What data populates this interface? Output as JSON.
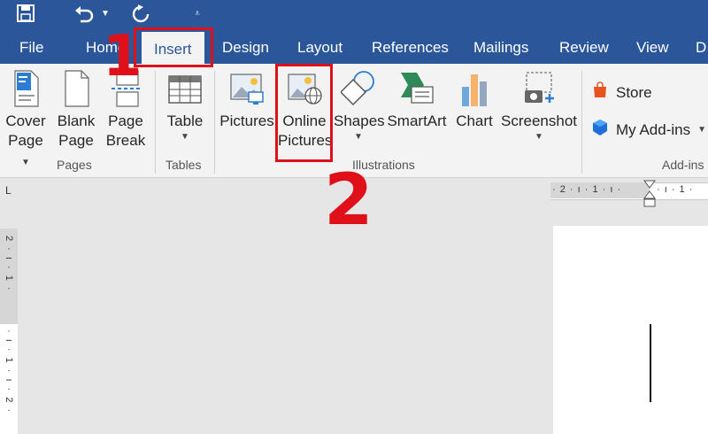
{
  "quick_access": {
    "icons": [
      "save-icon",
      "undo-icon",
      "redo-icon",
      "customize-qat-icon"
    ]
  },
  "tabs": [
    {
      "label": "File"
    },
    {
      "label": "Home"
    },
    {
      "label": "Insert",
      "active": true
    },
    {
      "label": "Design"
    },
    {
      "label": "Layout"
    },
    {
      "label": "References"
    },
    {
      "label": "Mailings"
    },
    {
      "label": "Review"
    },
    {
      "label": "View"
    },
    {
      "label": "D"
    }
  ],
  "ribbon": {
    "pages": {
      "group_label": "Pages",
      "cover_page": {
        "line1": "Cover",
        "line2": "Page"
      },
      "blank_page": {
        "line1": "Blank",
        "line2": "Page"
      },
      "page_break": {
        "line1": "Page",
        "line2": "Break"
      }
    },
    "tables": {
      "group_label": "Tables",
      "table": {
        "label": "Table"
      }
    },
    "illustrations": {
      "group_label": "Illustrations",
      "pictures": {
        "label": "Pictures"
      },
      "online_pictures": {
        "line1": "Online",
        "line2": "Pictures"
      },
      "shapes": {
        "label": "Shapes"
      },
      "smartart": {
        "label": "SmartArt"
      },
      "chart": {
        "label": "Chart"
      },
      "screenshot": {
        "label": "Screenshot"
      }
    },
    "addins": {
      "group_label": "Add-ins",
      "store": {
        "label": "Store"
      },
      "my_addins": {
        "label": "My Add-ins"
      }
    }
  },
  "rulers": {
    "corner_symbol": "L",
    "horizontal_text": "· 2 · ı · 1 · ı ·",
    "horizontal_right_text": "· ı · 1 ·",
    "vertical_top_text": "2 · ı · 1 ·",
    "vertical_bottom_text": "· ı · 1 · ı · 2 ·"
  },
  "annotations": {
    "step1": "1",
    "step2": "2",
    "color": "#e0101a"
  },
  "colors": {
    "brand": "#2b579a",
    "ribbon_bg": "#f3f3f3"
  }
}
